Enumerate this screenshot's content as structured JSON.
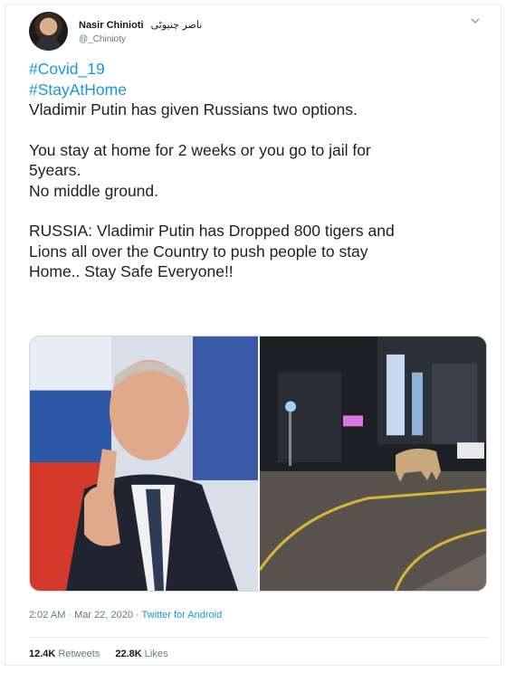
{
  "tweet": {
    "author": {
      "display_name": "Nasir Chinioti",
      "urdu_name": "ناصر چنیوٹی",
      "handle": "@_Chinioty"
    },
    "hashtags": [
      "#Covid_19",
      "#StayAtHome"
    ],
    "lines": [
      "Vladimir Putin has given Russians two options.",
      "",
      "You stay at home for 2 weeks or you go to jail for",
      "5years.",
      "No middle ground.",
      "",
      "RUSSIA: Vladimir Putin has Dropped 800 tigers and",
      "Lions all over the Country to push people to stay",
      "Home.. Stay Safe Everyone!!"
    ],
    "timestamp": "2:02 AM · Mar 22, 2020 · ",
    "source": "Twitter for Android",
    "retweets": "12.4K",
    "retweets_label": "Retweets",
    "likes": "22.8K",
    "likes_label": "Likes"
  },
  "colors": {
    "link": "#1b95e0",
    "muted": "#657786",
    "text": "#1c2022",
    "border": "#e6ecf0"
  },
  "icons": {
    "caret": "chevron-down-icon"
  }
}
